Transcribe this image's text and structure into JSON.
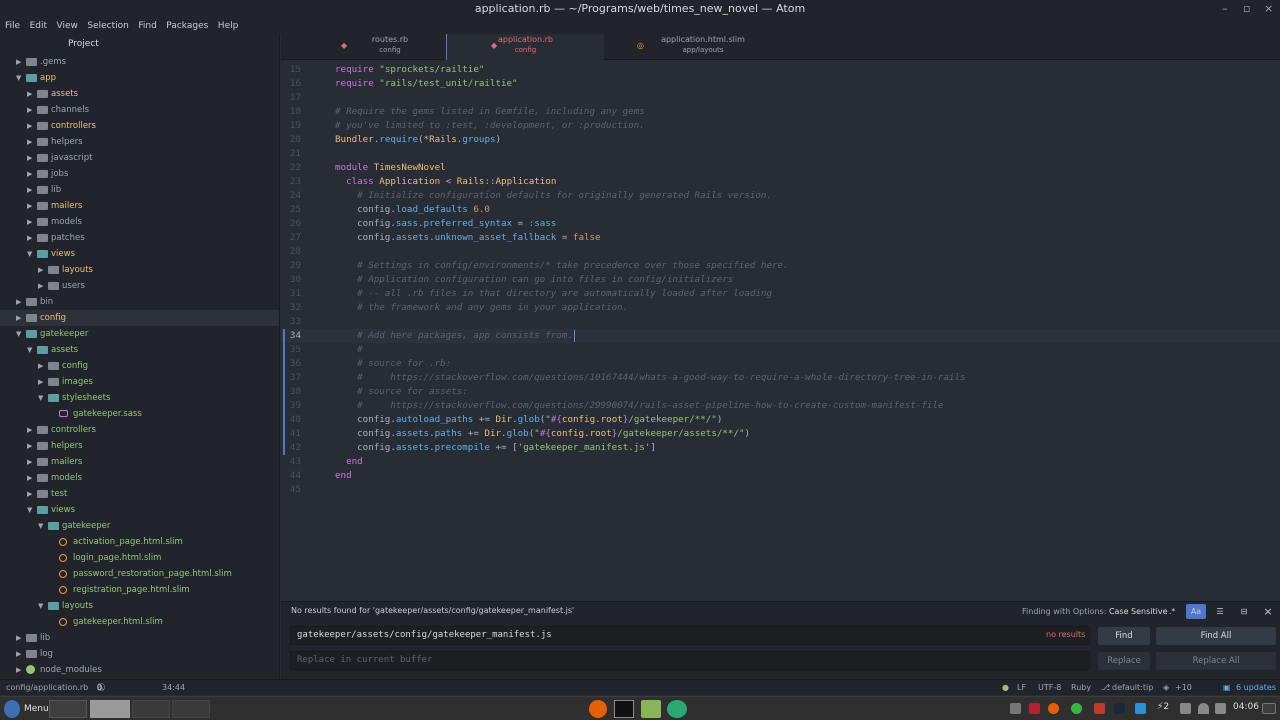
{
  "window": {
    "title": "application.rb — ~/Programs/web/times_new_novel — Atom",
    "controls": [
      "–",
      "▫",
      "×"
    ]
  },
  "menu": [
    "File",
    "Edit",
    "View",
    "Selection",
    "Find",
    "Packages",
    "Help"
  ],
  "sidebar": {
    "title": "Project",
    "tree": [
      {
        "label": ".gems",
        "depth": 1,
        "expanded": false,
        "kind": "folder",
        "color": "plain"
      },
      {
        "label": "app",
        "depth": 1,
        "expanded": true,
        "kind": "folder",
        "color": "yellow"
      },
      {
        "label": "assets",
        "depth": 2,
        "expanded": false,
        "kind": "folder",
        "color": "yellow"
      },
      {
        "label": "channels",
        "depth": 2,
        "expanded": false,
        "kind": "folder",
        "color": "plain"
      },
      {
        "label": "controllers",
        "depth": 2,
        "expanded": false,
        "kind": "folder",
        "color": "yellow"
      },
      {
        "label": "helpers",
        "depth": 2,
        "expanded": false,
        "kind": "folder",
        "color": "plain"
      },
      {
        "label": "javascript",
        "depth": 2,
        "expanded": false,
        "kind": "folder",
        "color": "plain"
      },
      {
        "label": "jobs",
        "depth": 2,
        "expanded": false,
        "kind": "folder",
        "color": "plain"
      },
      {
        "label": "lib",
        "depth": 2,
        "expanded": false,
        "kind": "folder",
        "color": "plain"
      },
      {
        "label": "mailers",
        "depth": 2,
        "expanded": false,
        "kind": "folder",
        "color": "yellow"
      },
      {
        "label": "models",
        "depth": 2,
        "expanded": false,
        "kind": "folder",
        "color": "plain"
      },
      {
        "label": "patches",
        "depth": 2,
        "expanded": false,
        "kind": "folder",
        "color": "plain"
      },
      {
        "label": "views",
        "depth": 2,
        "expanded": true,
        "kind": "folder",
        "color": "yellow"
      },
      {
        "label": "layouts",
        "depth": 3,
        "expanded": false,
        "kind": "folder",
        "color": "yellow"
      },
      {
        "label": "users",
        "depth": 3,
        "expanded": false,
        "kind": "folder",
        "color": "plain"
      },
      {
        "label": "bin",
        "depth": 1,
        "expanded": false,
        "kind": "folder",
        "color": "plain"
      },
      {
        "label": "config",
        "depth": 1,
        "expanded": false,
        "kind": "folder",
        "color": "yellow",
        "selected": true
      },
      {
        "label": "gatekeeper",
        "depth": 1,
        "expanded": true,
        "kind": "folder",
        "color": "green"
      },
      {
        "label": "assets",
        "depth": 2,
        "expanded": true,
        "kind": "folder",
        "color": "green"
      },
      {
        "label": "config",
        "depth": 3,
        "expanded": false,
        "kind": "folder",
        "color": "green"
      },
      {
        "label": "images",
        "depth": 3,
        "expanded": false,
        "kind": "folder",
        "color": "green"
      },
      {
        "label": "stylesheets",
        "depth": 3,
        "expanded": true,
        "kind": "folder",
        "color": "green"
      },
      {
        "label": "gatekeeper.sass",
        "depth": 4,
        "expanded": null,
        "kind": "sass",
        "color": "green"
      },
      {
        "label": "controllers",
        "depth": 2,
        "expanded": false,
        "kind": "folder",
        "color": "green"
      },
      {
        "label": "helpers",
        "depth": 2,
        "expanded": false,
        "kind": "folder",
        "color": "green"
      },
      {
        "label": "mailers",
        "depth": 2,
        "expanded": false,
        "kind": "folder",
        "color": "green"
      },
      {
        "label": "models",
        "depth": 2,
        "expanded": false,
        "kind": "folder",
        "color": "green"
      },
      {
        "label": "test",
        "depth": 2,
        "expanded": false,
        "kind": "folder",
        "color": "green"
      },
      {
        "label": "views",
        "depth": 2,
        "expanded": true,
        "kind": "folder",
        "color": "green"
      },
      {
        "label": "gatekeeper",
        "depth": 3,
        "expanded": true,
        "kind": "folder",
        "color": "green"
      },
      {
        "label": "activation_page.html.slim",
        "depth": 4,
        "expanded": null,
        "kind": "slim",
        "color": "green"
      },
      {
        "label": "login_page.html.slim",
        "depth": 4,
        "expanded": null,
        "kind": "slim",
        "color": "green"
      },
      {
        "label": "password_restoration_page.html.slim",
        "depth": 4,
        "expanded": null,
        "kind": "slim",
        "color": "green"
      },
      {
        "label": "registration_page.html.slim",
        "depth": 4,
        "expanded": null,
        "kind": "slim",
        "color": "green"
      },
      {
        "label": "layouts",
        "depth": 3,
        "expanded": true,
        "kind": "folder",
        "color": "green"
      },
      {
        "label": "gatekeeper.html.slim",
        "depth": 4,
        "expanded": null,
        "kind": "slim",
        "color": "green"
      },
      {
        "label": "lib",
        "depth": 1,
        "expanded": false,
        "kind": "folder",
        "color": "plain"
      },
      {
        "label": "log",
        "depth": 1,
        "expanded": false,
        "kind": "folder",
        "color": "plain"
      },
      {
        "label": "node_modules",
        "depth": 1,
        "expanded": false,
        "kind": "gem",
        "color": "plain"
      }
    ]
  },
  "tabs": [
    {
      "name": "routes.rb",
      "dir": "config",
      "active": false
    },
    {
      "name": "application.rb",
      "dir": "config",
      "active": true
    },
    {
      "name": "application.html.slim",
      "dir": "app/layouts",
      "active": false
    }
  ],
  "editor": {
    "current_line": 34,
    "lines": [
      {
        "n": 15,
        "t": "require \"sprockets/railtie\""
      },
      {
        "n": 16,
        "t": "require \"rails/test_unit/railtie\""
      },
      {
        "n": 17,
        "t": ""
      },
      {
        "n": 18,
        "t": "# Require the gems listed in Gemfile, including any gems"
      },
      {
        "n": 19,
        "t": "# you've limited to :test, :development, or :production."
      },
      {
        "n": 20,
        "t": "Bundler.require(*Rails.groups)"
      },
      {
        "n": 21,
        "t": ""
      },
      {
        "n": 22,
        "t": "module TimesNewNovel"
      },
      {
        "n": 23,
        "t": "  class Application < Rails::Application"
      },
      {
        "n": 24,
        "t": "    # Initialize configuration defaults for originally generated Rails version."
      },
      {
        "n": 25,
        "t": "    config.load_defaults 6.0"
      },
      {
        "n": 26,
        "t": "    config.sass.preferred_syntax = :sass"
      },
      {
        "n": 27,
        "t": "    config.assets.unknown_asset_fallback = false"
      },
      {
        "n": 28,
        "t": ""
      },
      {
        "n": 29,
        "t": "    # Settings in config/environments/* take precedence over those specified here."
      },
      {
        "n": 30,
        "t": "    # Application configuration can go into files in config/initializers"
      },
      {
        "n": 31,
        "t": "    # -- all .rb files in that directory are automatically loaded after loading"
      },
      {
        "n": 32,
        "t": "    # the framework and any gems in your application."
      },
      {
        "n": 33,
        "t": ""
      },
      {
        "n": 34,
        "t": "    # Add here packages, app consists from."
      },
      {
        "n": 35,
        "t": "    #"
      },
      {
        "n": 36,
        "t": "    # source for .rb:"
      },
      {
        "n": 37,
        "t": "    #     https://stackoverflow.com/questions/10167444/whats-a-good-way-to-require-a-whole-directory-tree-in-rails"
      },
      {
        "n": 38,
        "t": "    # source for assets:"
      },
      {
        "n": 39,
        "t": "    #     https://stackoverflow.com/questions/29990074/rails-asset-pipeline-how-to-create-custom-manifest-file"
      },
      {
        "n": 40,
        "t": "    config.autoload_paths += Dir.glob(\"#{config.root}/gatekeeper/**/\")"
      },
      {
        "n": 41,
        "t": "    config.assets.paths += Dir.glob(\"#{config.root}/gatekeeper/assets/**/\")"
      },
      {
        "n": 42,
        "t": "    config.assets.precompile += ['gatekeeper_manifest.js']"
      },
      {
        "n": 43,
        "t": "  end"
      },
      {
        "n": 44,
        "t": "end"
      },
      {
        "n": 45,
        "t": ""
      }
    ]
  },
  "find": {
    "message": "No results found for 'gatekeeper/assets/config/gatekeeper_manifest.js'",
    "options_label": "Finding with Options:",
    "options_value": "Case Sensitive",
    "option_buttons": [
      ".*",
      "Aa",
      "☰",
      "⊟"
    ],
    "close": "×",
    "find_value": "gatekeeper/assets/config/gatekeeper_manifest.js",
    "no_results": "no results",
    "replace_placeholder": "Replace in current buffer",
    "find_label": "Find",
    "find_all_label": "Find All",
    "replace_label": "Replace",
    "replace_all_label": "Replace All"
  },
  "status": {
    "path": "config/application.rb",
    "errors": "0",
    "warnings": "0",
    "infos": "0",
    "position": "34:44",
    "line_ending": "LF",
    "encoding": "UTF-8",
    "grammar": "Ruby",
    "branch": "default:tip",
    "diff": "+10",
    "updates": "6 updates"
  },
  "taskbar": {
    "menu_label": "Menu",
    "clock": "04:06",
    "workspace": "2"
  },
  "colors": {
    "accent": "#4d78cc",
    "folder_yellow": "#e5c07b",
    "folder_green": "#98c379",
    "error": "#e06c75"
  }
}
